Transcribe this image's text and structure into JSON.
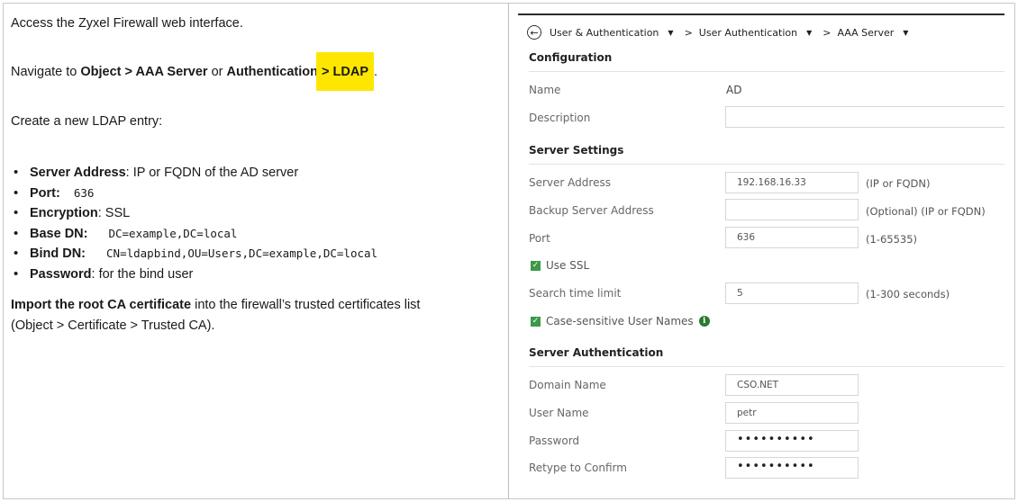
{
  "left": {
    "line1": "Access the Zyxel Firewall web interface.",
    "nav_prefix": "Navigate to ",
    "nav_path1": "Object > AAA Server",
    "nav_or": " or ",
    "nav_path2_a": "Authentication",
    "nav_path2_b": " > LDAP",
    "nav_end": ".",
    "create": "Create a new LDAP entry:",
    "bullets": [
      {
        "key": "Server Address",
        "sep": ": ",
        "text": "IP or FQDN of the AD server"
      },
      {
        "key": "Port:",
        "code": "636"
      },
      {
        "key": "Encryption",
        "sep": ": ",
        "text": "SSL"
      },
      {
        "key": "Base DN:",
        "code": "DC=example,DC=local"
      },
      {
        "key": "Bind DN:",
        "code": "CN=ldapbind,OU=Users,DC=example,DC=local"
      },
      {
        "key": "Password",
        "sep": ": ",
        "text": "for the bind user"
      }
    ],
    "import_bold": "Import the root CA certificate",
    "import_rest": " into the firewall’s trusted certificates list",
    "import_line2": "(Object > Certificate > Trusted CA)."
  },
  "breadcrumb": {
    "back_icon": "circle-arrow-left-icon",
    "item1": "User & Authentication",
    "item2": "User Authentication",
    "item3": "AAA Server",
    "sep": ">",
    "caret": "▼"
  },
  "config": {
    "title": "Configuration",
    "name_label": "Name",
    "name_value": "AD",
    "desc_label": "Description",
    "desc_value": ""
  },
  "server": {
    "title": "Server Settings",
    "addr_label": "Server Address",
    "addr_value": "192.168.16.33",
    "addr_hint": "(IP or FQDN)",
    "backup_label": "Backup Server Address",
    "backup_value": "",
    "backup_hint": "(Optional) (IP or FQDN)",
    "port_label": "Port",
    "port_value": "636",
    "port_hint": "(1-65535)",
    "ssl_label": "Use SSL",
    "ssl_checked": true,
    "search_label": "Search time limit",
    "search_value": "5",
    "search_hint": "(1-300 seconds)",
    "case_label": "Case-sensitive User Names",
    "case_checked": true
  },
  "auth": {
    "title": "Server Authentication",
    "domain_label": "Domain Name",
    "domain_value": "CSO.NET",
    "user_label": "User Name",
    "user_value": "petr",
    "pass_label": "Password",
    "pass_value": "••••••••••",
    "retype_label": "Retype to Confirm",
    "retype_value": "••••••••••"
  },
  "colors": {
    "highlight": "#ffe600",
    "checkbox": "#3c9a4a",
    "info": "#287a30"
  }
}
